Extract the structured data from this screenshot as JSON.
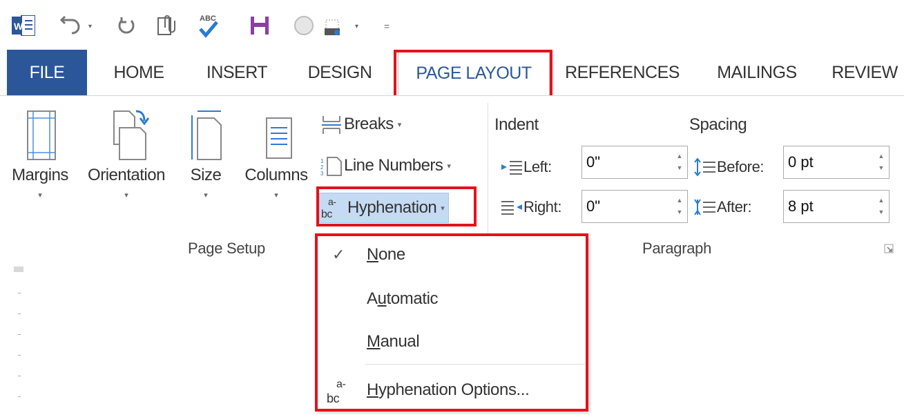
{
  "qat": {
    "icons": [
      "word-logo-icon",
      "undo-icon",
      "redo-icon",
      "attach-icon",
      "spelling-icon",
      "save-icon",
      "circle-icon",
      "customize-icon"
    ]
  },
  "tabs": [
    "FILE",
    "HOME",
    "INSERT",
    "DESIGN",
    "PAGE LAYOUT",
    "REFERENCES",
    "MAILINGS",
    "REVIEW"
  ],
  "active_tab": "PAGE LAYOUT",
  "page_setup": {
    "margins": "Margins",
    "orientation": "Orientation",
    "size": "Size",
    "columns": "Columns",
    "breaks": "Breaks",
    "line_numbers": "Line Numbers",
    "hyphenation": "Hyphenation",
    "group_label": "Page Setup"
  },
  "paragraph": {
    "indent_title": "Indent",
    "spacing_title": "Spacing",
    "left_label": "Left:",
    "right_label": "Right:",
    "left_value": "0\"",
    "right_value": "0\"",
    "before_label": "Before:",
    "after_label": "After:",
    "before_value": "0 pt",
    "after_value": "8 pt",
    "group_label": "Paragraph"
  },
  "hyphenation_menu": {
    "none": {
      "pre": "",
      "u": "N",
      "post": "one"
    },
    "automatic": {
      "pre": "A",
      "u": "u",
      "post": "tomatic"
    },
    "manual": {
      "pre": "",
      "u": "M",
      "post": "anual"
    },
    "options": {
      "pre": "",
      "u": "H",
      "post": "yphenation Options..."
    },
    "selected": "None",
    "check_glyph": "✓"
  },
  "colors": {
    "accent": "#2b579a",
    "highlight_box": "#e3121b",
    "hover": "#c5daf3"
  }
}
